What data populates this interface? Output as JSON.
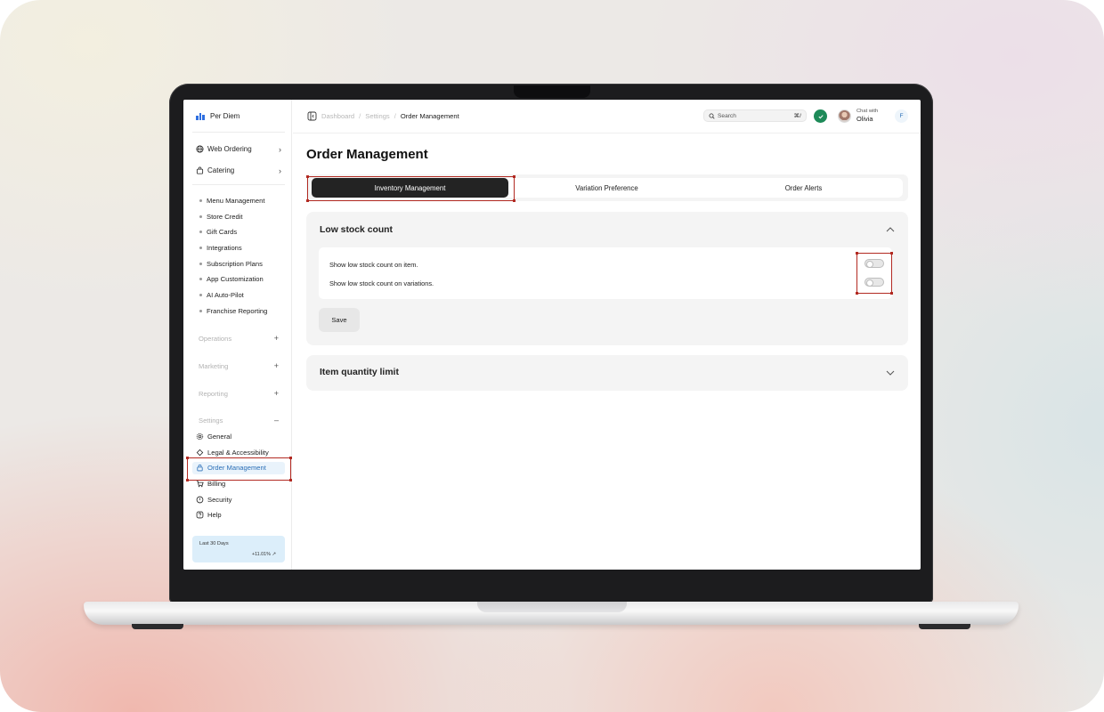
{
  "brand": {
    "name": "Per Diem"
  },
  "sidebar": {
    "top_items": [
      {
        "label": "Web Ordering",
        "icon": "globe-icon"
      },
      {
        "label": "Catering",
        "icon": "bag-icon"
      }
    ],
    "sub_items": [
      "Menu Management",
      "Store Credit",
      "Gift Cards",
      "Integrations",
      "Subscription Plans",
      "App Customization",
      "AI Auto-Pilot",
      "Franchise Reporting"
    ],
    "sections": [
      {
        "label": "Operations",
        "toggle": "+"
      },
      {
        "label": "Marketing",
        "toggle": "+"
      },
      {
        "label": "Reporting",
        "toggle": "+"
      },
      {
        "label": "Settings",
        "toggle": "–"
      }
    ],
    "settings_items": [
      {
        "label": "General",
        "icon": "gear-icon"
      },
      {
        "label": "Legal & Accessibility",
        "icon": "scale-icon"
      },
      {
        "label": "Order Management",
        "icon": "lock-icon",
        "active": true
      },
      {
        "label": "Billing",
        "icon": "cart-icon"
      },
      {
        "label": "Security",
        "icon": "shield-icon"
      },
      {
        "label": "Help",
        "icon": "help-icon"
      }
    ],
    "stats": {
      "title": "Last 30 Days",
      "value": "+11.01%"
    }
  },
  "topbar": {
    "breadcrumb": [
      "Dashboard",
      "Settings",
      "Order Management"
    ],
    "separator": "/",
    "search": {
      "placeholder": "Search",
      "shortcut": "⌘/"
    },
    "chat": {
      "prefix": "Chat with",
      "name": "Olivia"
    },
    "user_initial": "F"
  },
  "main": {
    "title": "Order Management",
    "tabs": [
      {
        "label": "Inventory Management",
        "active": true
      },
      {
        "label": "Variation Preference",
        "active": false
      },
      {
        "label": "Order Alerts",
        "active": false
      }
    ],
    "low_stock": {
      "title": "Low stock count",
      "expanded": true,
      "options": [
        {
          "label": "Show low stock count on item.",
          "enabled": false
        },
        {
          "label": "Show low stock count on variations.",
          "enabled": false
        }
      ],
      "save_label": "Save"
    },
    "quantity_limit": {
      "title": "Item quantity limit",
      "expanded": false
    }
  },
  "colors": {
    "accent": "#2b6fb7",
    "active_tab": "#232323",
    "success": "#1d8a58",
    "highlight": "#b22a22"
  }
}
